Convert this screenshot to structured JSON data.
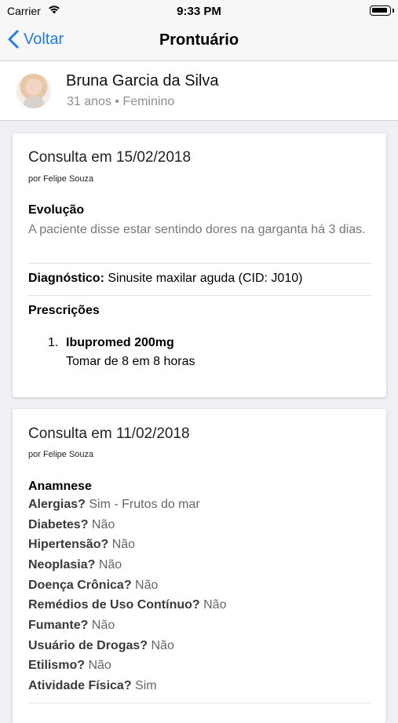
{
  "status": {
    "carrier": "Carrier",
    "time": "9:33 PM"
  },
  "nav": {
    "back_label": "Voltar",
    "title": "Prontuário"
  },
  "patient": {
    "name": "Bruna Garcia da Silva",
    "meta": "31 anos • Feminino"
  },
  "consultations": [
    {
      "title": "Consulta em 15/02/2018",
      "by": "por Felipe Souza",
      "evolution_label": "Evolução",
      "evolution_text": "A paciente disse estar sentindo dores na garganta há 3 dias.",
      "diagnosis_label": "Diagnóstico:",
      "diagnosis_value": "Sinusite maxilar aguda (CID: J010)",
      "prescriptions_label": "Prescrições",
      "prescriptions": [
        {
          "number": "1.",
          "name": "Ibupromed 200mg",
          "instructions": "Tomar de 8 em 8 horas"
        }
      ]
    },
    {
      "title": "Consulta em 11/02/2018",
      "by": "por Felipe Souza",
      "anamnesis_label": "Anamnese",
      "anamnesis": [
        {
          "q": "Alergias?",
          "a": "Sim - Frutos do mar"
        },
        {
          "q": "Diabetes?",
          "a": "Não"
        },
        {
          "q": "Hipertensão?",
          "a": "Não"
        },
        {
          "q": "Neoplasia?",
          "a": "Não"
        },
        {
          "q": "Doença Crônica?",
          "a": "Não"
        },
        {
          "q": "Remédios de Uso Contínuo?",
          "a": "Não"
        },
        {
          "q": "Fumante?",
          "a": "Não"
        },
        {
          "q": "Usuário de Drogas?",
          "a": "Não"
        },
        {
          "q": "Etilismo?",
          "a": "Não"
        },
        {
          "q": "Atividade Física?",
          "a": "Sim"
        }
      ]
    }
  ]
}
